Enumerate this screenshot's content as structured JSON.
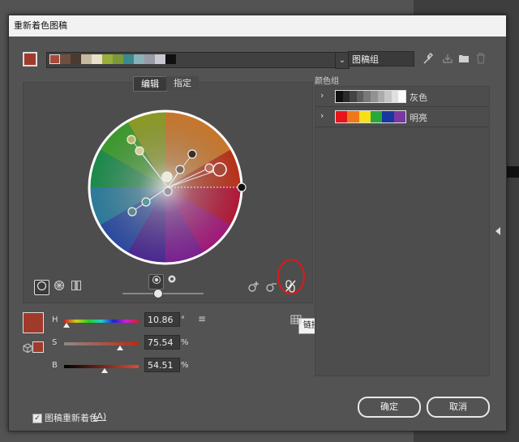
{
  "dialog": {
    "title": "重新着色图稿",
    "artwork_name": "图稿组",
    "dropdown_icon": "chevron-down-icon",
    "current_color": "#a03a2a",
    "palette_colors": [
      "#a84a3a",
      "#6e5040",
      "#4a3a30",
      "#c8b8a0",
      "#e8e0c8",
      "#9aae3a",
      "#7a9a3a",
      "#3a8a90",
      "#8ab0b8",
      "#9a9aa8",
      "#c8c8d0",
      "#111111"
    ]
  },
  "tabs": {
    "edit": "编辑",
    "assign": "指定"
  },
  "color_groups": {
    "label": "颜色组",
    "groups": [
      {
        "name": "灰色",
        "colors": [
          "#111111",
          "#2a2a2a",
          "#444444",
          "#5e5e5e",
          "#787878",
          "#929292",
          "#acacac",
          "#c6c6c6",
          "#e0e0e0",
          "#fafafa"
        ]
      },
      {
        "name": "明亮",
        "colors": [
          "#e8141c",
          "#f07818",
          "#f8e018",
          "#28a838",
          "#1838a0",
          "#7a38a0"
        ]
      }
    ]
  },
  "hsb": {
    "h": {
      "label": "H",
      "value": "10.86",
      "unit": "°",
      "position": 0.03
    },
    "s": {
      "label": "S",
      "value": "75.54",
      "unit": "%",
      "position": 0.755
    },
    "b": {
      "label": "B",
      "value": "54.51",
      "unit": "%",
      "position": 0.545
    }
  },
  "tooltip": "链接协调颜色",
  "footer": {
    "recolor_checkbox": "图稿重新着色",
    "recolor_shortcut": "(A)",
    "recolor_checked": true,
    "ok": "确定",
    "cancel": "取消"
  },
  "highlight_color": "#e01818"
}
